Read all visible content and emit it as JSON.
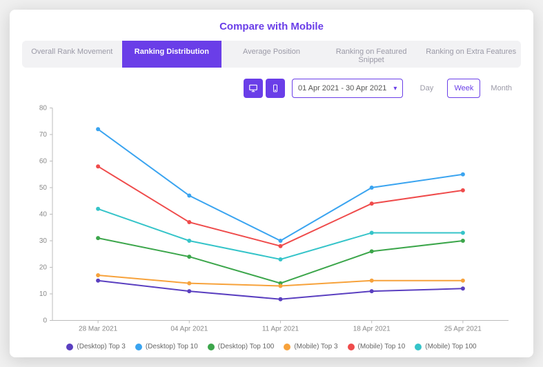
{
  "title": "Compare with Mobile",
  "tabs": [
    {
      "label": "Overall Rank Movement",
      "active": false
    },
    {
      "label": "Ranking Distribution",
      "active": true
    },
    {
      "label": "Average Position",
      "active": false
    },
    {
      "label": "Ranking on Featured Snippet",
      "active": false
    },
    {
      "label": "Ranking on Extra Features",
      "active": false
    }
  ],
  "device_toggle": {
    "desktop_active": true,
    "mobile_active": true
  },
  "date_range": "01 Apr 2021 - 30 Apr 2021",
  "period_buttons": [
    {
      "label": "Day",
      "active": false
    },
    {
      "label": "Week",
      "active": true
    },
    {
      "label": "Month",
      "active": false
    }
  ],
  "colors": {
    "desktop_top3": "#5a3fc0",
    "desktop_top10": "#3aa4f0",
    "desktop_top100": "#3ca64b",
    "mobile_top3": "#f7a23b",
    "mobile_top10": "#ef4b4b",
    "mobile_top100": "#35c4c9"
  },
  "legend": [
    {
      "label": "(Desktop) Top 3",
      "colorKey": "desktop_top3"
    },
    {
      "label": "(Desktop) Top 10",
      "colorKey": "desktop_top10"
    },
    {
      "label": "(Desktop) Top 100",
      "colorKey": "desktop_top100"
    },
    {
      "label": "(Mobile) Top 3",
      "colorKey": "mobile_top3"
    },
    {
      "label": "(Mobile) Top 10",
      "colorKey": "mobile_top10"
    },
    {
      "label": "(Mobile) Top 100",
      "colorKey": "mobile_top100"
    }
  ],
  "chart_data": {
    "type": "line",
    "xlabel": "",
    "ylabel": "",
    "ylim": [
      0,
      80
    ],
    "yticks": [
      0,
      10,
      20,
      30,
      40,
      50,
      60,
      70,
      80
    ],
    "categories": [
      "28 Mar 2021",
      "04 Apr 2021",
      "11 Apr 2021",
      "18 Apr 2021",
      "25 Apr 2021"
    ],
    "series": [
      {
        "name": "(Desktop) Top 3",
        "colorKey": "desktop_top3",
        "values": [
          15,
          11,
          8,
          11,
          12
        ]
      },
      {
        "name": "(Desktop) Top 10",
        "colorKey": "desktop_top10",
        "values": [
          72,
          47,
          30,
          50,
          55
        ]
      },
      {
        "name": "(Desktop) Top 100",
        "colorKey": "desktop_top100",
        "values": [
          31,
          24,
          14,
          26,
          30
        ]
      },
      {
        "name": "(Mobile) Top 3",
        "colorKey": "mobile_top3",
        "values": [
          17,
          14,
          13,
          15,
          15
        ]
      },
      {
        "name": "(Mobile) Top 10",
        "colorKey": "mobile_top10",
        "values": [
          58,
          37,
          28,
          44,
          49
        ]
      },
      {
        "name": "(Mobile) Top 100",
        "colorKey": "mobile_top100",
        "values": [
          42,
          30,
          23,
          33,
          33
        ]
      }
    ]
  }
}
